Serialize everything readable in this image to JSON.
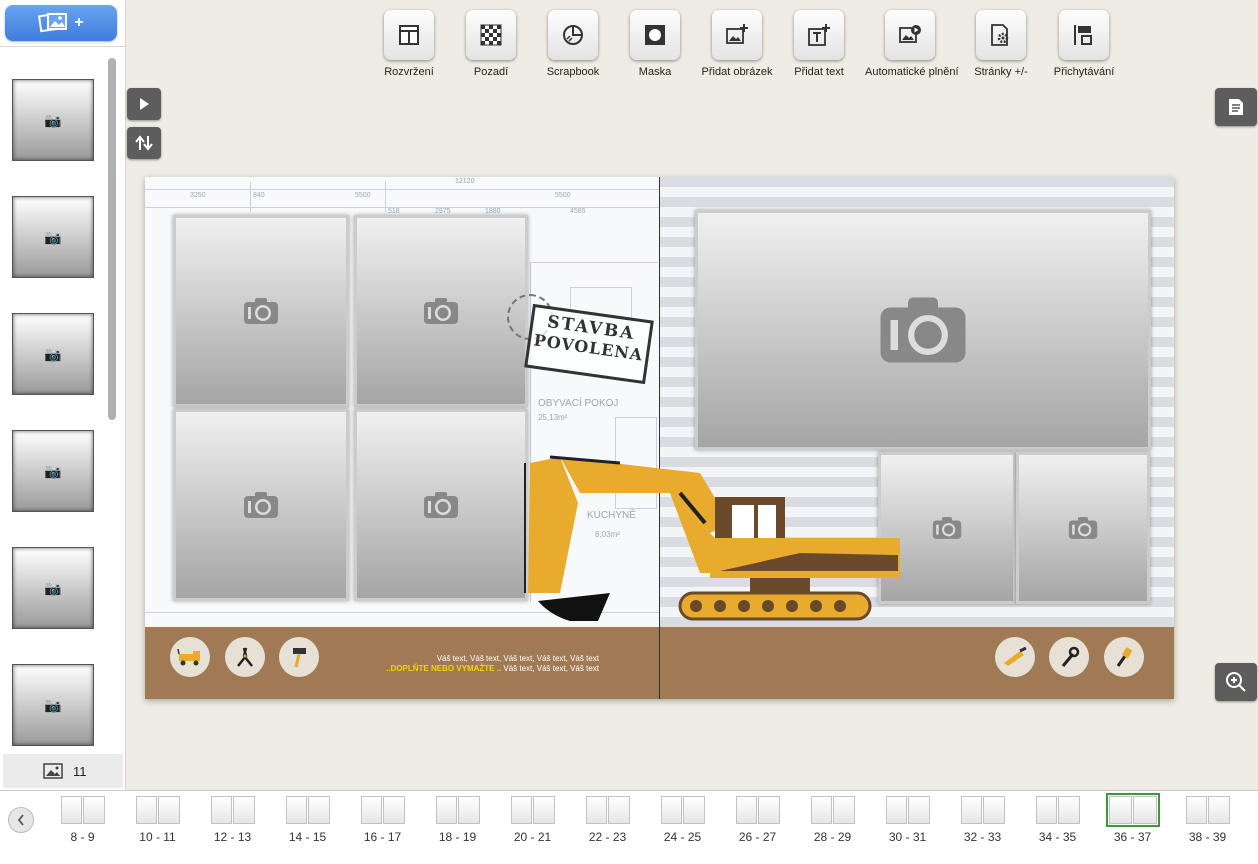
{
  "left_panel": {
    "add_photos_label": "+",
    "photo_count": "11"
  },
  "toolbar": [
    {
      "label": "Rozvržení",
      "icon": "layout-icon"
    },
    {
      "label": "Pozadí",
      "icon": "background-icon"
    },
    {
      "label": "Scrapbook",
      "icon": "scrapbook-icon"
    },
    {
      "label": "Maska",
      "icon": "mask-icon"
    },
    {
      "label": "Přidat obrázek",
      "icon": "add-image-icon"
    },
    {
      "label": "Přidat text",
      "icon": "add-text-icon"
    },
    {
      "label": "Automatické plnění",
      "icon": "autofill-icon"
    },
    {
      "label": "Stránky +/-",
      "icon": "pages-settings-icon"
    },
    {
      "label": "Přichytávání",
      "icon": "snap-icon"
    }
  ],
  "spread": {
    "stamp_line1": "STAVBA",
    "stamp_line2": "POVOLENA",
    "room1_name": "OBYVACÍ POKOJ",
    "room1_area": "25,13m²",
    "room2_name": "KUCHYNĚ",
    "room2_area": "8,03m²",
    "dim_labels": [
      "3250",
      "840",
      "5500",
      "12120",
      "5500",
      "4585",
      "518",
      "2975",
      "1880"
    ],
    "text_line1": "Váš text, Váš text, Váš text, Váš text, Váš text",
    "text_line2_highlight": "..DOPLŇTE NEBO VYMAŽTE ..",
    "text_line2_rest": " Váš text, Váš text, Váš text"
  },
  "page_strip": [
    "8 - 9",
    "10 - 11",
    "12 - 13",
    "14 - 15",
    "16 - 17",
    "18 - 19",
    "20 - 21",
    "22 - 23",
    "24 - 25",
    "26 - 27",
    "28 - 29",
    "30 - 31",
    "32 - 33",
    "34 - 35",
    "36 - 37",
    "38 - 39"
  ],
  "selected_spread": "36 - 37",
  "colors": {
    "accent_blue": "#4a86e6",
    "brown_band": "#a07a55",
    "excavator_yellow": "#e8ab2e",
    "selected_border": "#3a9a3a",
    "text_highlight": "#f5d400"
  }
}
